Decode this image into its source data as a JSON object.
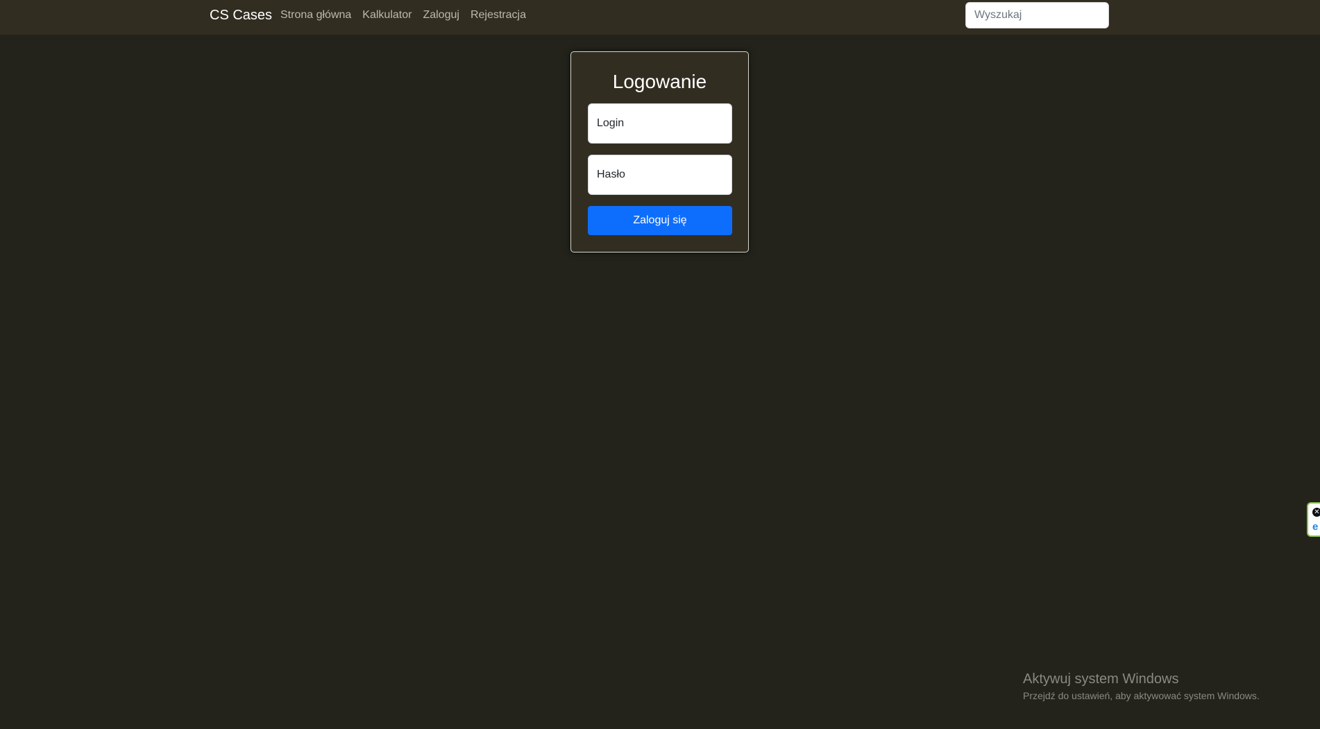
{
  "navbar": {
    "brand": "CS Cases",
    "links": [
      "Strona główna",
      "Kalkulator",
      "Zaloguj",
      "Rejestracja"
    ],
    "search_placeholder": "Wyszukaj"
  },
  "login_form": {
    "title": "Logowanie",
    "login_placeholder": "Login",
    "password_placeholder": "Hasło",
    "submit_label": "Zaloguj się",
    "submit_color": "#0d6efd"
  },
  "windows_activation": {
    "title": "Aktywuj system Windows",
    "subtitle": "Przejdź do ustawień, aby aktywować system Windows."
  },
  "extension_widget": {
    "close_icon": "close-icon",
    "logo_icon": "extension-logo-icon"
  }
}
